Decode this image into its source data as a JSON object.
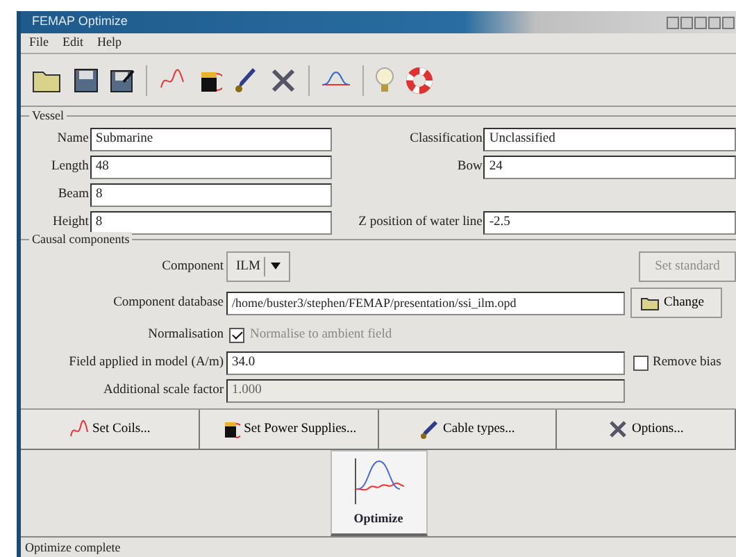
{
  "window": {
    "title": "FEMAP Optimize"
  },
  "menu": [
    "File",
    "Edit",
    "Help"
  ],
  "vessel": {
    "title": "Vessel",
    "rows": [
      {
        "left": {
          "label": "Name",
          "value": "Submarine"
        },
        "right": {
          "label": "Classification",
          "value": "Unclassified"
        }
      },
      {
        "left": {
          "label": "Length",
          "value": "48"
        },
        "right": {
          "label": "Bow",
          "value": "24"
        }
      },
      {
        "left": {
          "label": "Beam",
          "value": "8"
        }
      },
      {
        "left": {
          "label": "Height",
          "value": "8"
        },
        "right": {
          "label": "Z position of water line",
          "value": "-2.5"
        }
      }
    ]
  },
  "causal": {
    "title": "Causal components",
    "component": {
      "label": "Component",
      "value": "ILM"
    },
    "set_button": {
      "label": "Set standard",
      "disabled": true
    },
    "database": {
      "label": "Component database",
      "value": "/home/buster3/stephen/FEMAP/presentation/ssi_ilm.opd"
    },
    "change_button": {
      "label": "Change"
    },
    "normalisation": {
      "label": "Normalisation",
      "checked": true,
      "option_label": "Normalise to ambient field",
      "disabled": true
    },
    "field": {
      "label": "Field applied in model (A/m)",
      "value": "34.0"
    },
    "remove_bias": {
      "label": "Remove bias",
      "checked": false
    },
    "scale": {
      "label": "Additional scale factor",
      "value": "1.000",
      "disabled": true
    }
  },
  "actions": [
    {
      "kind": "coils",
      "label": "Set Coils..."
    },
    {
      "kind": "power",
      "label": "Set Power Supplies..."
    },
    {
      "kind": "cable",
      "label": "Cable types..."
    },
    {
      "kind": "options",
      "label": "Options..."
    }
  ],
  "optimize_button": {
    "label": "Optimize"
  },
  "status_bar": "Optimize complete"
}
